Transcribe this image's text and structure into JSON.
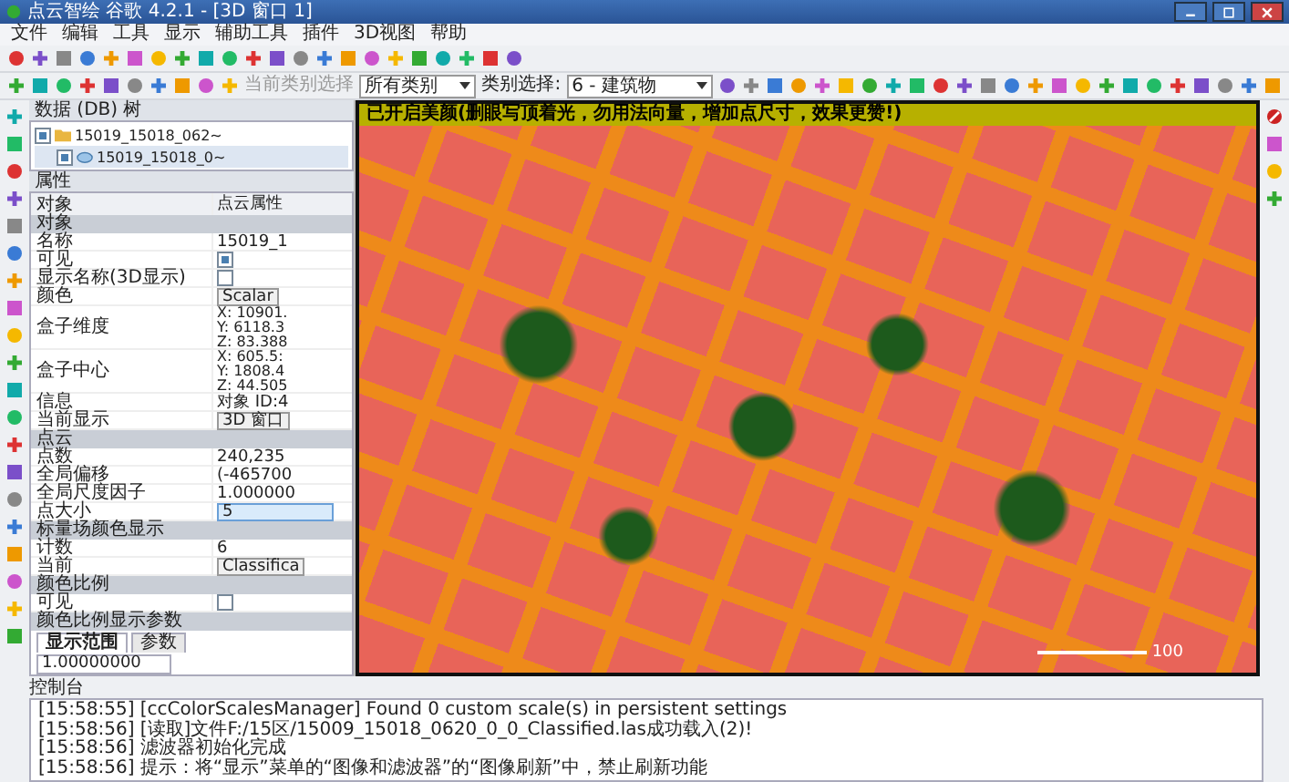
{
  "window": {
    "title": "点云智绘 谷歌 4.2.1 - [3D 窗口 1]"
  },
  "menu": [
    "文件",
    "编辑",
    "工具",
    "显示",
    "辅助工具",
    "插件",
    "3D视图",
    "帮助"
  ],
  "toolbar": {
    "class_label": {
      "text": "当前类别选择",
      "disabled": true
    },
    "class_combo": "所有类别",
    "select_label": "类别选择:",
    "select_combo": "6 - 建筑物"
  },
  "db_tree": {
    "title": "数据 (DB) 树",
    "items": [
      {
        "label": "15019_15018_062~",
        "checked": true,
        "selected": false,
        "children": [
          {
            "label": "15019_15018_0~",
            "checked": true,
            "selected": true
          }
        ]
      }
    ]
  },
  "properties": {
    "title": "属性",
    "columns": [
      "对象",
      "点云属性"
    ],
    "rows": [
      {
        "kind": "section",
        "label": "对象"
      },
      {
        "kind": "text",
        "label": "名称",
        "value": "15019_1"
      },
      {
        "kind": "check",
        "label": "可见",
        "checked": true
      },
      {
        "kind": "check",
        "label": "显示名称(3D显示)",
        "checked": false
      },
      {
        "kind": "button",
        "label": "颜色",
        "value": "Scalar"
      },
      {
        "kind": "multi",
        "label": "盒子维度",
        "lines": [
          "X: 10901.",
          "Y: 6118.3",
          "Z: 83.388"
        ]
      },
      {
        "kind": "multi",
        "label": "盒子中心",
        "lines": [
          "X: 605.5:",
          "Y: 1808.4",
          "Z: 44.505"
        ]
      },
      {
        "kind": "text",
        "label": "信息",
        "value": "对象 ID:4"
      },
      {
        "kind": "button",
        "label": "当前显示",
        "value": "3D 窗口"
      },
      {
        "kind": "section",
        "label": "点云"
      },
      {
        "kind": "text",
        "label": "点数",
        "value": "240,235"
      },
      {
        "kind": "text",
        "label": "全局偏移",
        "value": "(-465700"
      },
      {
        "kind": "text",
        "label": "全局尺度因子",
        "value": "1.000000"
      },
      {
        "kind": "spin",
        "label": "点大小",
        "value": "5"
      },
      {
        "kind": "section",
        "label": "标量场颜色显示"
      },
      {
        "kind": "text",
        "label": "计数",
        "value": "6"
      },
      {
        "kind": "button",
        "label": "当前",
        "value": "Classifica"
      },
      {
        "kind": "section",
        "label": "颜色比例"
      },
      {
        "kind": "check",
        "label": "可见",
        "checked": false
      },
      {
        "kind": "section",
        "label": "颜色比例显示参数"
      }
    ],
    "tabs": [
      {
        "label": "显示范围",
        "selected": true
      },
      {
        "label": "参数",
        "selected": false
      }
    ],
    "range_value": "1.00000000"
  },
  "view": {
    "banner": "已开启美颜(删眼写顶着光，勿用法向量，增加点尺寸，效果更赞!)",
    "scale_label": "100"
  },
  "console": {
    "title": "控制台",
    "lines": [
      "[15:58:55] [ccColorScalesManager] Found 0 custom scale(s) in persistent settings",
      "[15:58:56] [读取]文件F:/15区/15009_15018_0620_0_0_Classified.las成功载入(2)!",
      "[15:58:56] 滤波器初始化完成",
      "[15:58:56] 提示：将“显示”菜单的“图像和滤波器”的“图像刷新”中，禁止刷新功能"
    ]
  }
}
